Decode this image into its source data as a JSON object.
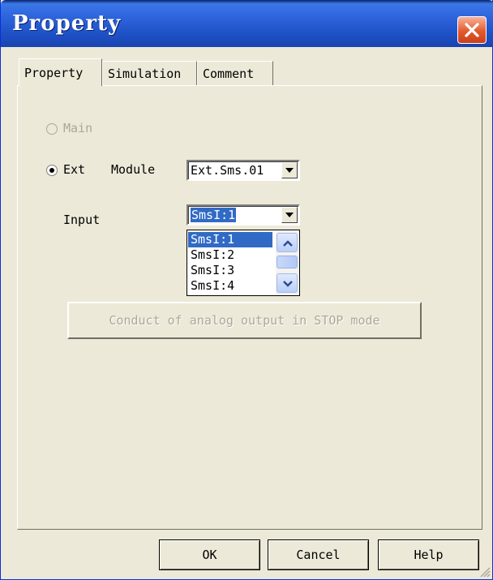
{
  "window": {
    "title": "Property"
  },
  "tabs": [
    {
      "label": "Property",
      "active": true
    },
    {
      "label": "Simulation",
      "active": false
    },
    {
      "label": "Comment",
      "active": false
    }
  ],
  "radio_main": {
    "label": "Main",
    "checked": false,
    "disabled": true
  },
  "radio_ext": {
    "label": "Ext",
    "checked": true,
    "disabled": false
  },
  "module": {
    "label": "Module",
    "value": "Ext.Sms.01"
  },
  "input": {
    "label": "Input",
    "value": "SmsI:1",
    "options": [
      "SmsI:1",
      "SmsI:2",
      "SmsI:3",
      "SmsI:4"
    ],
    "highlighted_index": 0
  },
  "conduct_button": {
    "label": "Conduct of analog output in STOP  mode",
    "disabled": true
  },
  "footer": {
    "ok_label": "OK",
    "cancel_label": "Cancel",
    "help_label": "Help"
  },
  "colors": {
    "title_bar": "#2C62DA",
    "close_button": "#E25A2C",
    "dialog_bg": "#ECE9D8",
    "selection": "#316AC5"
  }
}
